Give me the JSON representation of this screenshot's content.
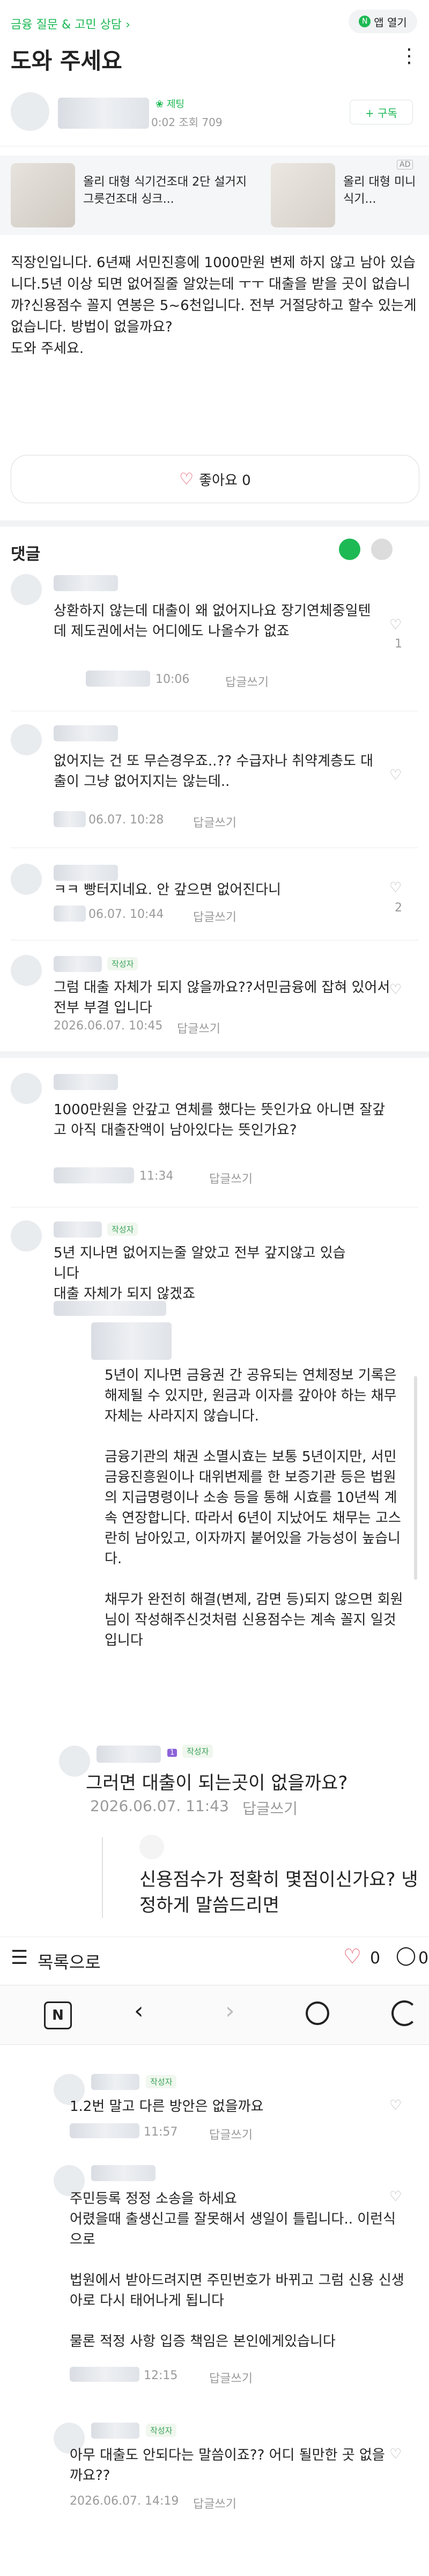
{
  "header": {
    "category": "금융 질문 & 고민 상담",
    "app_open": "앱 열기",
    "title": "도와 주세요",
    "more": "⋮"
  },
  "author": {
    "icon_label": "제팅",
    "meta": "0:02 조회 709",
    "subscribe": "+ 구독"
  },
  "ad": {
    "badge": "AD",
    "item1": "올리 대형 식기건조대 2단 설거지 그릇건조대 싱크...",
    "item2": "올리 대형 미니식기..."
  },
  "post": {
    "body": "직장인입니다. 6년째 서민진흥에 1000만원 변제 하지 않고 남아 있습니다.5년 이상 되면 없어질줄 알았는데 ㅜㅜ 대출을 받을 곳이 없습니까?신용점수 꼴지 연봉은 5~6천입니다. 전부 거절당하고 할수 있는게 없습니다. 방법이 없을까요?\n도와 주세요.",
    "like_label": "좋아요 0"
  },
  "comments_section": {
    "title": "댓글"
  },
  "comments": [
    {
      "text": "상환하지 않는데 대출이 왜 없어지나요 장기연체중일텐데 제도권에서는 어디에도 나올수가 없죠",
      "meta": "10:06",
      "reply": "답글쓰기",
      "likes": "1"
    },
    {
      "text": "없어지는 건 또 무슨경우죠..?? 수급자나 취약계층도 대출이 그냥 없어지지는 않는데..",
      "meta": "06.07. 10:28",
      "reply": "답글쓰기",
      "likes": ""
    },
    {
      "text": "ㅋㅋ 빵터지네요. 안 갚으면 없어진다니",
      "meta": "06.07. 10:44",
      "reply": "답글쓰기",
      "likes": "2"
    },
    {
      "author_badge": "작성자",
      "text": "그럼 대출 자체가 되지 않을까요??서민금융에 잡혀 있어서 전부 부결 입니다",
      "meta": "2026.06.07. 10:45",
      "reply": "답글쓰기",
      "likes": ""
    },
    {
      "text": "1000만원을 안갚고 연체를 했다는 뜻인가요 아니면 잘갚고 아직 대출잔액이 남아있다는 뜻인가요?",
      "meta": "11:34",
      "reply": "답글쓰기",
      "likes": ""
    },
    {
      "author_badge": "작성자",
      "text": "5년 지나면 없어지는줄 알았고 전부 갚지않고 있습니다\n대출 자체가 되지 않겠죠",
      "meta": "",
      "reply": "",
      "likes": ""
    },
    {
      "text": "5년이 지나면 금융권 간 공유되는 연체정보 기록은 해제될 수 있지만, 원금과 이자를 갚아야 하는 채무 자체는 사라지지 않습니다.\n\n금융기관의 채권 소멸시효는 보통 5년이지만, 서민금융진흥원이나 대위변제를 한 보증기관 등은 법원의 지급명령이나 소송 등을 통해 시효를 10년씩 계속 연장합니다. 따라서 6년이 지났어도 채무는 고스란히 남아있고, 이자까지 붙어있을 가능성이 높습니다.\n\n채무가 완전히 해결(변제, 감면 등)되지 않으면 회원님이 작성해주신것처럼 신용점수는 계속 꼴지 일것입니다",
      "meta": "",
      "reply": "",
      "likes": ""
    },
    {
      "author_badge": "작성자",
      "num_badge": "1",
      "text": "그러면 대출이 되는곳이 없을까요?",
      "meta": "2026.06.07. 11:43",
      "reply": "답글쓰기",
      "likes": ""
    }
  ],
  "reply_quote": "신용점수가 정확히 몇점이신가요? 냉정하게 말씀드리면",
  "bottom_bar": {
    "list_label": "목록으로",
    "heart_count": "0",
    "chat_count": "0"
  },
  "browser_bar": {
    "n_icon": "N"
  },
  "comments2": [
    {
      "author_badge": "작성자",
      "text": "1.2번 말고 다른 방안은 없을까요",
      "meta": "11:57",
      "reply": "답글쓰기"
    },
    {
      "text": "주민등록 정정 소송을 하세요\n어렸을때 출생신고를 잘못해서 생일이 틀립니다.. 이런식으로\n\n법원에서 받아드려지면 주민번호가 바뀌고 그럼 신용 신생아로 다시 태어나게 됩니다\n\n물론 적정 사항 입증 책임은 본인에게있습니다",
      "meta": "12:15",
      "reply": "답글쓰기"
    },
    {
      "author_badge": "작성자",
      "text": "아무 대출도 안되다는 말씀이죠?? 어디 될만한 곳 없을까요??",
      "meta": "2026.06.07. 14:19",
      "reply": "답글쓰기"
    }
  ],
  "colors": {
    "accent": "#1db954",
    "author_badge": "#3aa35a",
    "number_badge": "#8c63d9"
  }
}
